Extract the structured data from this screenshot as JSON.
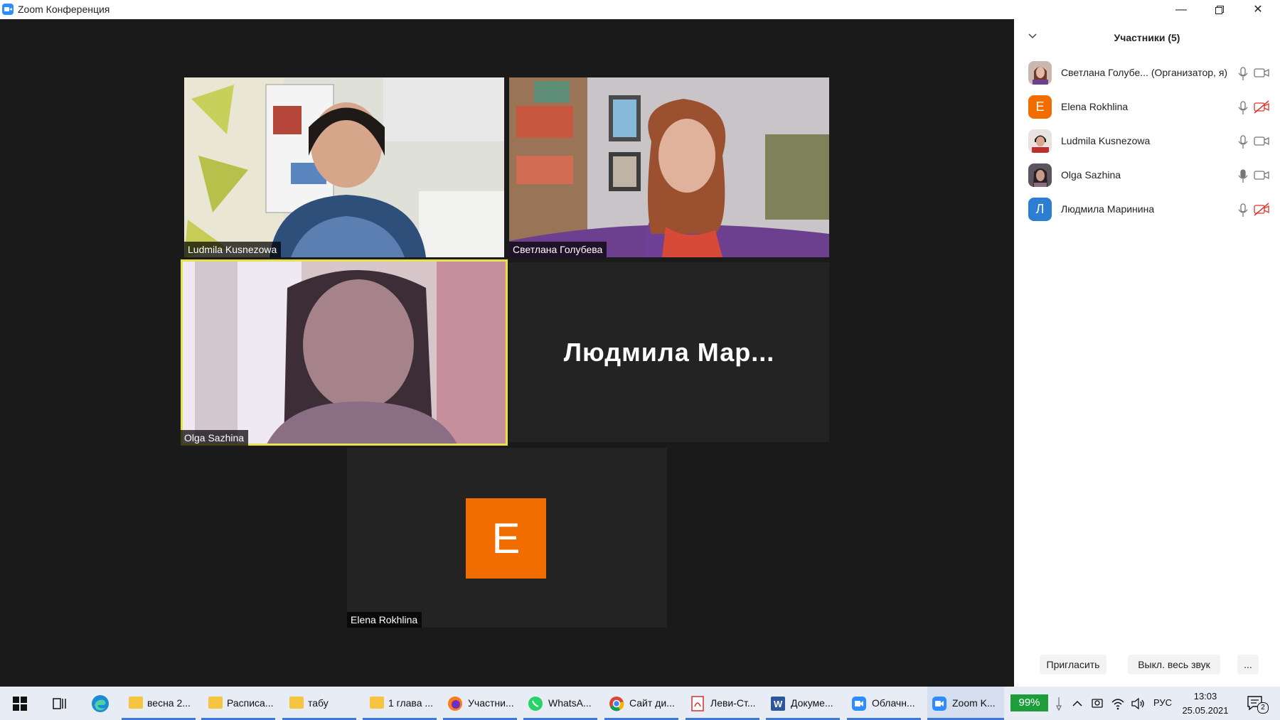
{
  "window": {
    "title": "Zoom Конференция",
    "controls": [
      "minimize",
      "restore",
      "close"
    ]
  },
  "tiles": [
    {
      "name": "Ludmila Kusnezowa",
      "video": true
    },
    {
      "name": "Светлана Голубева",
      "video": true
    },
    {
      "name": "Olga Sazhina",
      "video": true,
      "active_speaker": true
    },
    {
      "name": "Людмила  Мар...",
      "video": false
    },
    {
      "name": "Elena Rokhlina",
      "video": false,
      "avatar_letter": "E",
      "avatar_color": "#f26d00"
    }
  ],
  "participants_panel": {
    "title": "Участники (5)",
    "participants": [
      {
        "name": "Светлана Голубе... (Организатор, я)",
        "avatar": "photo",
        "mic": "on",
        "video": "on"
      },
      {
        "name": "Elena Rokhlina",
        "avatar_letter": "E",
        "avatar_color": "#f26d00",
        "mic": "on",
        "video": "off"
      },
      {
        "name": "Ludmila Kusnezowa",
        "avatar": "photo",
        "mic": "on",
        "video": "on"
      },
      {
        "name": "Olga Sazhina",
        "avatar": "photo",
        "mic": "on",
        "video": "on"
      },
      {
        "name": "Людмила Маринина",
        "avatar_letter": "Л",
        "avatar_color": "#2d7dd2",
        "mic": "on",
        "video": "off"
      }
    ],
    "buttons": {
      "invite": "Пригласить",
      "mute_all": "Выкл. весь звук",
      "more": "..."
    }
  },
  "taskbar": {
    "items": [
      {
        "label": "весна 2...",
        "icon": "folder-icon"
      },
      {
        "label": "Расписа...",
        "icon": "folder-icon"
      },
      {
        "label": "табу",
        "icon": "folder-icon"
      },
      {
        "label": "1 глава ...",
        "icon": "folder-icon"
      },
      {
        "label": "Участни...",
        "icon": "firefox-icon"
      },
      {
        "label": "WhatsA...",
        "icon": "whatsapp-icon"
      },
      {
        "label": "Сайт ди...",
        "icon": "chrome-icon"
      },
      {
        "label": "Леви-Ст...",
        "icon": "pdf-icon"
      },
      {
        "label": "Докуме...",
        "icon": "word-icon"
      },
      {
        "label": "Облачн...",
        "icon": "zoom-icon"
      },
      {
        "label": "Zoom K...",
        "icon": "zoom-icon"
      }
    ],
    "battery": "99%",
    "language": "РУС",
    "time": "13:03",
    "date": "25.05.2021",
    "notifications": "2"
  }
}
